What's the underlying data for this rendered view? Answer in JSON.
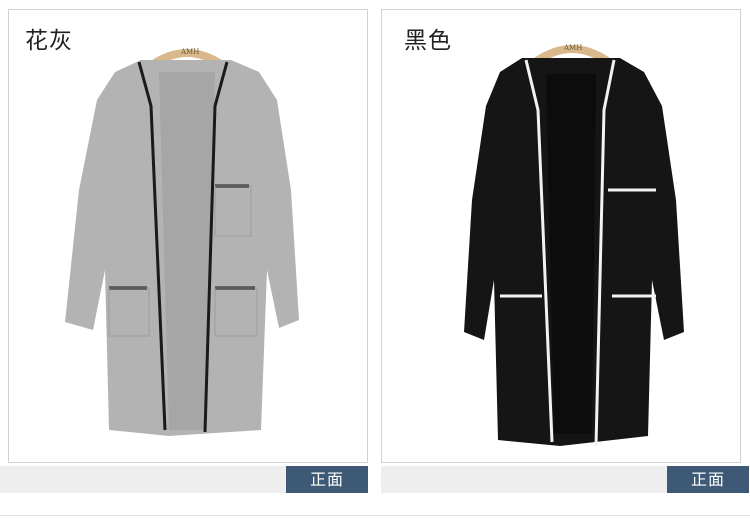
{
  "products": [
    {
      "color_name": "花灰",
      "view_label": "正面",
      "hanger_brand": "AMH",
      "body_color": "#b3b3b3",
      "trim_color": "#1a1a1a"
    },
    {
      "color_name": "黑色",
      "view_label": "正面",
      "hanger_brand": "AMH",
      "body_color": "#151515",
      "trim_color": "#f2f2f2"
    }
  ]
}
